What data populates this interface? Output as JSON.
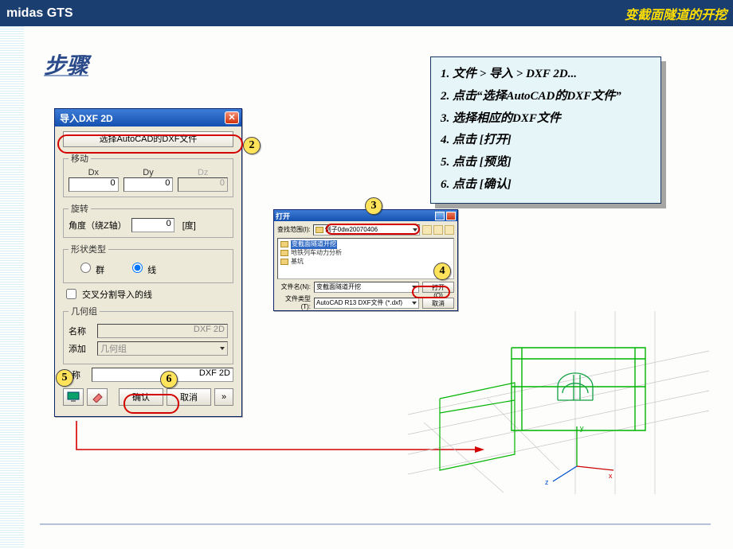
{
  "header": {
    "brand": "midas GTS",
    "subtitle": "变截面隧道的开挖"
  },
  "steps_title": "步骤",
  "instructions": {
    "s1": "1. 文件 > 导入 > DXF 2D...",
    "s2": "2. 点击“选择AutoCAD的DXF文件”",
    "s3": "3. 选择相应的DXF文件",
    "s4": "4. 点击 [打开]",
    "s5": "5. 点击 [预览]",
    "s6": "6. 点击 [确认]"
  },
  "dlg1": {
    "title": "导入DXF 2D",
    "select_btn": "选择AutoCAD的DXF文件",
    "move_group": "移动",
    "dx": "Dx",
    "dy": "Dy",
    "dz": "Dz",
    "dx_val": "0",
    "dy_val": "0",
    "dz_val": "0",
    "rotate_group": "旋转",
    "angle_label": "角度（绕Z轴）",
    "angle_val": "0",
    "unit_deg": "[度]",
    "shape_group": "形状类型",
    "radio_group": "群",
    "radio_line": "线",
    "chk_cross": "交叉分割导入的线",
    "geom_group": "几何组",
    "name_label": "名称",
    "name_ph": "DXF 2D",
    "add_label": "添加",
    "add_ph": "几何组",
    "name2_label": "名称",
    "name2_ph": "DXF 2D",
    "ok": "确认",
    "cancel": "取消",
    "arrow": "»"
  },
  "dlg2": {
    "title": "打开",
    "look_label": "查找范围(I):",
    "look_val": "例子0dw20070406",
    "file1": "变截面隧道开挖",
    "file2": "地铁列车动力分析",
    "file3": "基坑",
    "fn_label": "文件名(N):",
    "fn_val": "变截面隧道开挖",
    "ft_label": "文件类型(T):",
    "ft_val": "AutoCAD R13 DXF文件 (*.dxf)",
    "open_btn": "打开(O)",
    "cancel_btn": "取消"
  },
  "callouts": {
    "c2": "2",
    "c3": "3",
    "c4": "4",
    "c5": "5",
    "c6": "6"
  }
}
